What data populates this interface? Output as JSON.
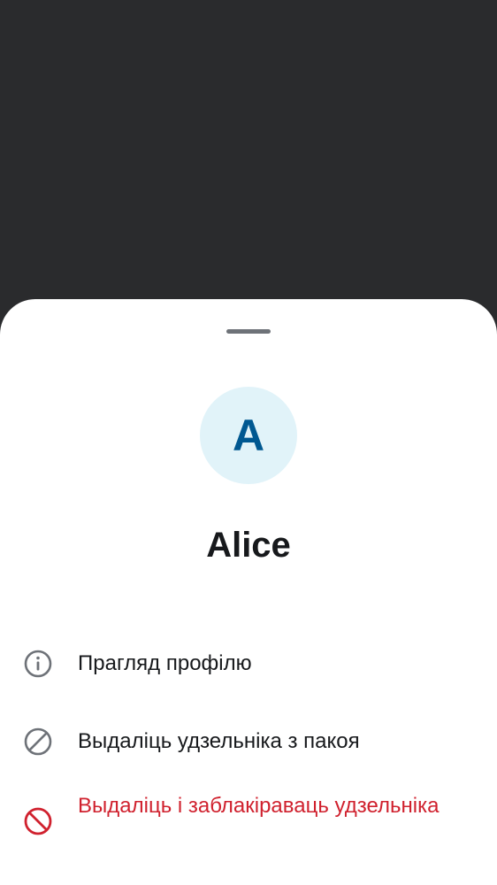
{
  "user": {
    "avatar_initial": "A",
    "name": "Alice"
  },
  "actions": [
    {
      "label": "Прагляд профілю",
      "icon": "info-icon"
    },
    {
      "label": "Выдаліць удзельніка з пакоя",
      "icon": "block-icon"
    },
    {
      "label": "Выдаліць і заблакіраваць удзельніка",
      "icon": "ban-icon"
    }
  ],
  "colors": {
    "scrim": "#2a2b2d",
    "sheet": "#ffffff",
    "avatar_bg": "#e1f3f9",
    "avatar_text": "#005891",
    "text_primary": "#17191c",
    "icon_gray": "#6e7278",
    "danger": "#d0212e"
  }
}
